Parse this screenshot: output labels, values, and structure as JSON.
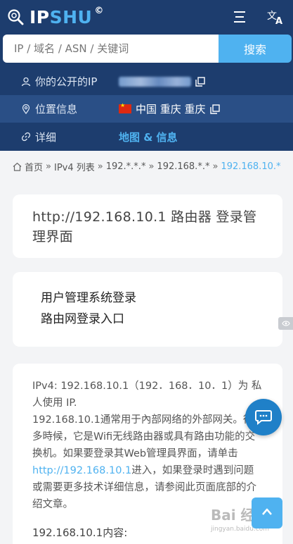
{
  "header": {
    "logo_main": "IP",
    "logo_accent": "SHU",
    "logo_mark": "©",
    "menu_icon": "hamburger-menu-icon",
    "lang_icon": "translate-icon"
  },
  "search": {
    "placeholder": "IP / 域名 / ASN / 关键词",
    "button_label": "搜索"
  },
  "info": {
    "public_ip_label": "你的公开的IP",
    "location_label": "位置信息",
    "location_value": "中国 重庆 重庆",
    "details_label": "详细",
    "details_link": "地图 & 信息"
  },
  "breadcrumb": {
    "items": [
      "首页",
      "IPv4 列表",
      "192.*.*.*",
      "192.168.*.*"
    ],
    "current": "192.168.10.*",
    "separator": "»"
  },
  "title_card": {
    "heading": "http://192.168.10.1 路由器 登录管理界面"
  },
  "links_card": {
    "link1": "用户管理系统登录",
    "link2": "路由网登录入口"
  },
  "desc_card": {
    "line1": "IPv4: 192.168.10.1（192．168．10．1）为 私人使用 IP.",
    "para_pre": "192.168.10.1通常用于內部网络的外部网关。很多時候，它是Wifi无线路由器或具有路由功能的交换机。如果要登录其Web管理員界面，请单击",
    "para_link": "http://192.168.10.1",
    "para_post": "进入，如果登录时遇到问题或需要更多技术详细信息，请参阅此页面底部的介绍文章。",
    "content_heading": "192.168.10.1内容:"
  },
  "watermark": {
    "text": "Bai 经验",
    "sub": "jingyan.baidu.com"
  },
  "colors": {
    "header_bg": "#1d3d6e",
    "accent": "#4fb2f0",
    "page_bg": "#f3f4f6"
  }
}
